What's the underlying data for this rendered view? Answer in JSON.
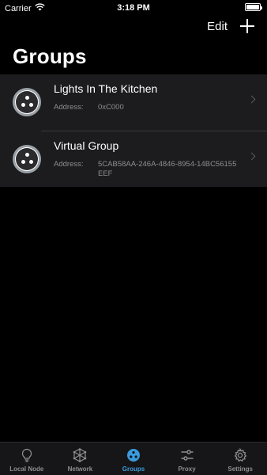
{
  "status_bar": {
    "carrier": "Carrier",
    "time": "3:18 PM",
    "battery_level": 1.0
  },
  "nav": {
    "edit_label": "Edit",
    "add_icon": "plus-icon"
  },
  "page": {
    "title": "Groups"
  },
  "groups": [
    {
      "name": "Lights In The Kitchen",
      "address_label": "Address:",
      "address": "0xC000"
    },
    {
      "name": "Virtual Group",
      "address_label": "Address:",
      "address": "5CAB58AA-246A-4846-8954-14BC56155EEF"
    }
  ],
  "tabs": [
    {
      "label": "Local Node",
      "icon": "lightbulb-icon",
      "active": false
    },
    {
      "label": "Network",
      "icon": "network-icon",
      "active": false
    },
    {
      "label": "Groups",
      "icon": "groups-icon",
      "active": true
    },
    {
      "label": "Proxy",
      "icon": "proxy-icon",
      "active": false
    },
    {
      "label": "Settings",
      "icon": "gear-icon",
      "active": false
    }
  ],
  "colors": {
    "accent": "#3a9bdc",
    "background": "#000000",
    "row": "#1c1c1e",
    "secondary_text": "#8e8e93"
  }
}
